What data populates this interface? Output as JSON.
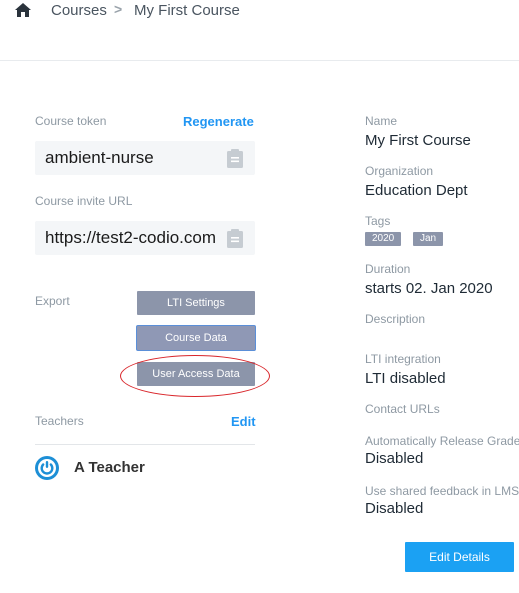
{
  "breadcrumb": {
    "root": "Courses",
    "separator": ">",
    "current": "My First Course"
  },
  "left": {
    "course_token_label": "Course token",
    "regenerate_label": "Regenerate",
    "course_token_value": "ambient-nurse",
    "invite_url_label": "Course invite URL",
    "invite_url_value": "https://test2-codio.com",
    "export_label": "Export",
    "buttons": {
      "lti_settings": "LTI Settings",
      "course_data": "Course Data",
      "user_access_data": "User Access Data"
    },
    "teachers_label": "Teachers",
    "edit_label": "Edit",
    "teacher_name": "A Teacher"
  },
  "right": {
    "name_label": "Name",
    "name_value": "My First Course",
    "organization_label": "Organization",
    "organization_value": "Education Dept",
    "tags_label": "Tags",
    "tags": [
      "2020",
      "Jan"
    ],
    "duration_label": "Duration",
    "duration_value": "starts 02. Jan 2020",
    "description_label": "Description",
    "lti_label": "LTI integration",
    "lti_value": "LTI disabled",
    "contact_label": "Contact URLs",
    "auto_release_label": "Automatically Release Grades",
    "auto_release_value": "Disabled",
    "shared_feedback_label": "Use shared feedback in LMS",
    "shared_feedback_value": "Disabled",
    "edit_details_label": "Edit Details"
  },
  "colors": {
    "accent": "#2196f3",
    "button": "#8c95aa",
    "primary_button": "#1ba1f3",
    "highlight": "#d9262b"
  }
}
